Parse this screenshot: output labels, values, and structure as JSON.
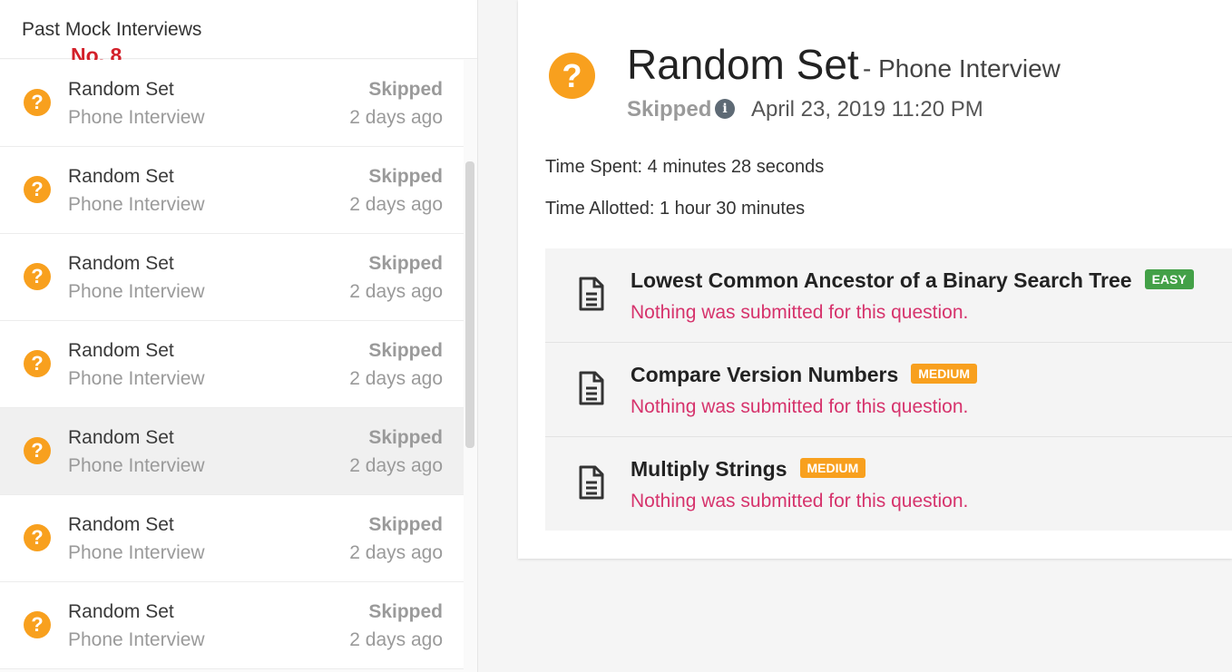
{
  "sidebar": {
    "title": "Past Mock Interviews",
    "annotation": "No. 8",
    "items": [
      {
        "title": "Random Set",
        "subtitle": "Phone Interview",
        "status": "Skipped",
        "time": "2 days ago"
      },
      {
        "title": "Random Set",
        "subtitle": "Phone Interview",
        "status": "Skipped",
        "time": "2 days ago"
      },
      {
        "title": "Random Set",
        "subtitle": "Phone Interview",
        "status": "Skipped",
        "time": "2 days ago"
      },
      {
        "title": "Random Set",
        "subtitle": "Phone Interview",
        "status": "Skipped",
        "time": "2 days ago"
      },
      {
        "title": "Random Set",
        "subtitle": "Phone Interview",
        "status": "Skipped",
        "time": "2 days ago"
      },
      {
        "title": "Random Set",
        "subtitle": "Phone Interview",
        "status": "Skipped",
        "time": "2 days ago"
      },
      {
        "title": "Random Set",
        "subtitle": "Phone Interview",
        "status": "Skipped",
        "time": "2 days ago"
      }
    ]
  },
  "detail": {
    "title": "Random Set",
    "subtitle": "- Phone Interview",
    "status": "Skipped",
    "date": "April 23, 2019 11:20 PM",
    "time_spent": "Time Spent: 4 minutes 28 seconds",
    "time_allotted": "Time Allotted: 1 hour 30 minutes",
    "questions": [
      {
        "title": "Lowest Common Ancestor of a Binary Search Tree",
        "difficulty": "EASY",
        "difficulty_color": "#43a047",
        "note": "Nothing was submitted for this question."
      },
      {
        "title": "Compare Version Numbers",
        "difficulty": "MEDIUM",
        "difficulty_color": "#f8a01e",
        "note": "Nothing was submitted for this question."
      },
      {
        "title": "Multiply Strings",
        "difficulty": "MEDIUM",
        "difficulty_color": "#f8a01e",
        "note": "Nothing was submitted for this question."
      }
    ]
  },
  "colors": {
    "accent": "#f8a01e",
    "easy": "#43a047",
    "error": "#d6336c"
  },
  "icons": {
    "status": "question-mark-icon",
    "info": "info-icon",
    "question": "document-icon"
  }
}
